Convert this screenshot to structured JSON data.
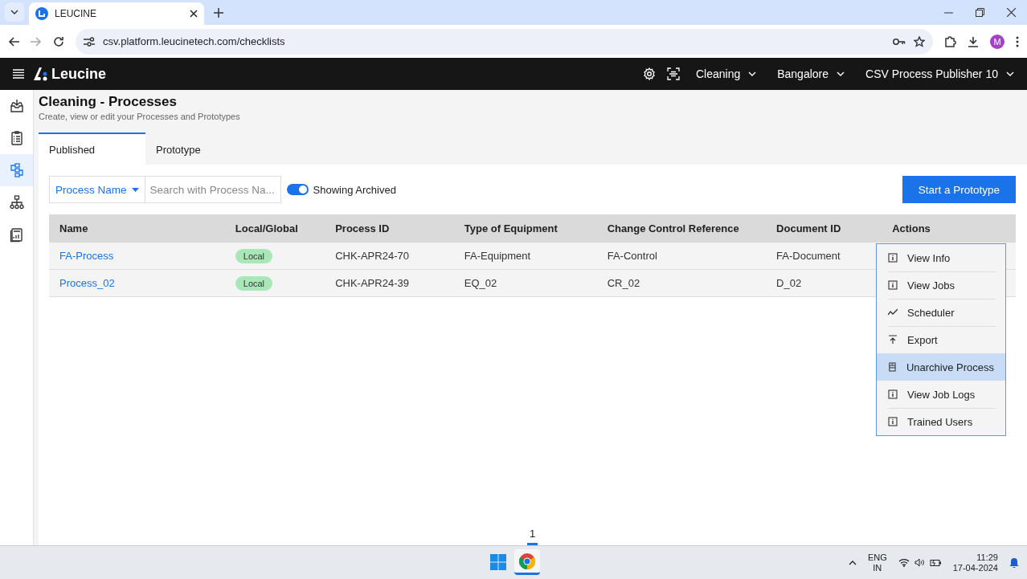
{
  "browser": {
    "tab_title": "LEUCINE",
    "url": "csv.platform.leucinetech.com/checklists",
    "profile_initial": "M"
  },
  "header": {
    "brand": "Leucine",
    "menus": [
      {
        "label": "Cleaning"
      },
      {
        "label": "Bangalore"
      },
      {
        "label": "CSV Process Publisher 10"
      }
    ]
  },
  "sidebar": {
    "items": [
      {
        "kind": "inbox",
        "selected": false
      },
      {
        "kind": "checklist",
        "selected": false
      },
      {
        "kind": "flow",
        "selected": true
      },
      {
        "kind": "hierarchy",
        "selected": false
      },
      {
        "kind": "report",
        "selected": false
      }
    ]
  },
  "page": {
    "title": "Cleaning - Processes",
    "subtitle": "Create, view or edit your Processes and Prototypes",
    "tabs": [
      {
        "label": "Published",
        "selected": true
      },
      {
        "label": "Prototype",
        "selected": false
      }
    ],
    "filter": {
      "label": "Process Name",
      "placeholder": "Search with Process Na..."
    },
    "archived_toggle": {
      "label": "Showing Archived",
      "on": true
    },
    "primary_button": "Start a Prototype",
    "table": {
      "columns": [
        "Name",
        "Local/Global",
        "Process ID",
        "Type of Equipment",
        "Change Control Reference",
        "Document ID",
        "Actions"
      ],
      "rows": [
        {
          "name": "FA-Process",
          "scope": "Local",
          "process_id": "CHK-APR24-70",
          "equipment": "FA-Equipment",
          "change_control": "FA-Control",
          "document_id": "FA-Document"
        },
        {
          "name": "Process_02",
          "scope": "Local",
          "process_id": "CHK-APR24-39",
          "equipment": "EQ_02",
          "change_control": "CR_02",
          "document_id": "D_02"
        }
      ]
    },
    "actions_menu": {
      "items": [
        {
          "label": "View Info",
          "kind": "info",
          "selected": false
        },
        {
          "label": "View Jobs",
          "kind": "info",
          "selected": false
        },
        {
          "label": "Scheduler",
          "kind": "trend",
          "selected": false
        },
        {
          "label": "Export",
          "kind": "export",
          "selected": false
        },
        {
          "label": "Unarchive Process",
          "kind": "archive",
          "selected": true
        },
        {
          "label": "View Job Logs",
          "kind": "info",
          "selected": false
        },
        {
          "label": "Trained Users",
          "kind": "info",
          "selected": false
        }
      ]
    },
    "pagination": {
      "pages": [
        {
          "label": "1",
          "selected": true
        }
      ]
    }
  },
  "taskbar": {
    "language": "ENG",
    "region": "IN",
    "time": "11:29",
    "date": "17-04-2024"
  }
}
